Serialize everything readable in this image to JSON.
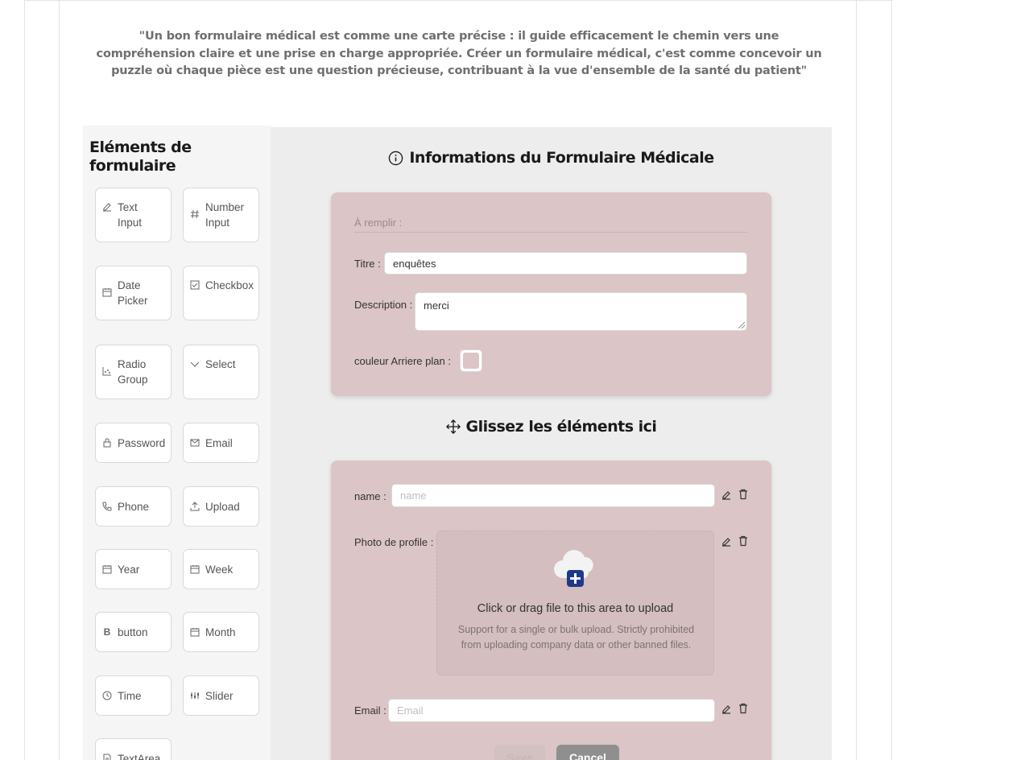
{
  "quote": "\"Un bon formulaire médical est comme une carte précise : il guide efficacement le chemin vers une compréhension claire et une prise en charge appropriée. Créer un formulaire médical, c'est comme concevoir un puzzle où chaque pièce est une question précieuse, contribuant à la vue d'ensemble de la santé du patient\"",
  "sidebar": {
    "title": "Eléments de formulaire",
    "items": [
      {
        "label": "Text Input",
        "icon": "edit-icon"
      },
      {
        "label": "Number Input",
        "icon": "hash-icon"
      },
      {
        "label": "Date Picker",
        "icon": "calendar-icon"
      },
      {
        "label": "Checkbox",
        "icon": "checkbox-icon"
      },
      {
        "label": "Radio Group",
        "icon": "dot-chart-icon"
      },
      {
        "label": "Select",
        "icon": "chevron-down-icon"
      },
      {
        "label": "Password",
        "icon": "lock-icon"
      },
      {
        "label": "Email",
        "icon": "mail-icon"
      },
      {
        "label": "Phone",
        "icon": "phone-icon"
      },
      {
        "label": "Upload",
        "icon": "upload-icon"
      },
      {
        "label": "Year",
        "icon": "calendar-icon"
      },
      {
        "label": "Week",
        "icon": "calendar-icon"
      },
      {
        "label": "button",
        "icon": "bold-icon"
      },
      {
        "label": "Month",
        "icon": "calendar-icon"
      },
      {
        "label": "Time",
        "icon": "clock-icon"
      },
      {
        "label": "Slider",
        "icon": "sliders-icon"
      },
      {
        "label": "TextArea",
        "icon": "file-text-icon"
      }
    ]
  },
  "info_section": {
    "title": "Informations du Formulaire Médicale",
    "fill_label": "À remplir :",
    "title_label": "Titre",
    "title_value": "enquêtes",
    "description_label": "Description",
    "description_value": "merci",
    "bg_color_label": "couleur Arriere plan :",
    "bg_color_value": "#dbc5c6"
  },
  "drop_section": {
    "title": "Glissez les éléments ici",
    "name_label": "name",
    "name_placeholder": "name",
    "photo_label": "Photo de profile",
    "upload_text": "Click or drag file to this area to upload",
    "upload_hint": "Support for a single or bulk upload. Strictly prohibited from uploading company data or other banned files.",
    "email_label": "Email",
    "email_placeholder": "Email",
    "save_label": "Save",
    "cancel_label": "Cancel"
  },
  "colors": {
    "card_background": "#dbc5c6",
    "canvas_background": "#ededed",
    "sidebar_background": "#f4f5f4",
    "upload_icon_accent": "#1f3a8a"
  }
}
